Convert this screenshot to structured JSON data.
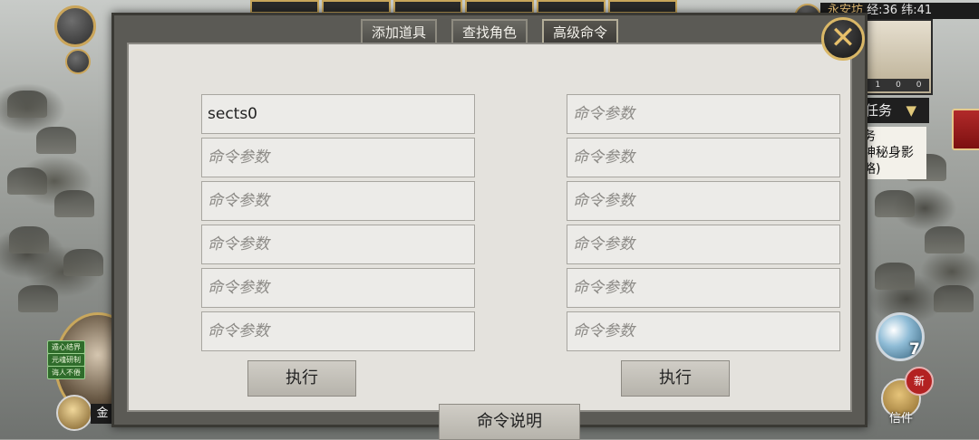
{
  "hud": {
    "coords": "经:36 纬:41",
    "quest_tab_label": "任务",
    "quest_tab_arrow": "▼",
    "quest_lines": [
      "务",
      "神秘身影",
      "略)"
    ],
    "minimap_counts": [
      "1",
      "0",
      "0"
    ],
    "yin_yang_count": "7",
    "mail_new_badge": "新",
    "mail_label": "信件",
    "gold_label": "金",
    "buffs": [
      "遁心结界",
      "元魂研制",
      "诲人不倦"
    ]
  },
  "dialog": {
    "tabs": [
      {
        "label": "添加道具",
        "active": false
      },
      {
        "label": "查找角色",
        "active": false
      },
      {
        "label": "高级命令",
        "active": true
      }
    ],
    "close_glyph": "✕",
    "placeholder": "命令参数",
    "left_fields": [
      "sects0",
      "",
      "",
      "",
      "",
      ""
    ],
    "right_fields": [
      "",
      "",
      "",
      "",
      "",
      ""
    ],
    "execute_label": "执行",
    "help_label": "命令说明"
  }
}
